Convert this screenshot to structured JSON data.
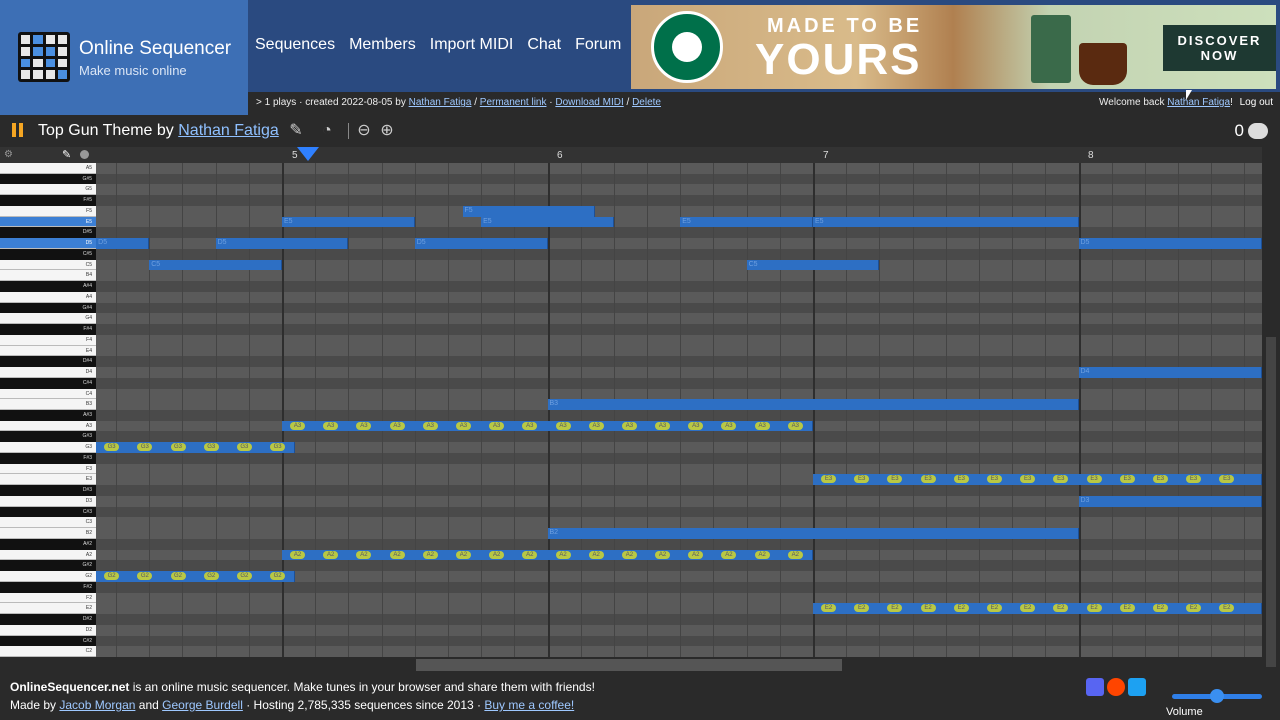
{
  "brand": {
    "title": "Online Sequencer",
    "subtitle": "Make music online"
  },
  "nav": {
    "items": [
      "Sequences",
      "Members",
      "Import MIDI",
      "Chat",
      "Forum"
    ]
  },
  "ad": {
    "line1": "MADE TO BE",
    "line2": "YOURS",
    "cta1": "DISCOVER",
    "cta2": "NOW",
    "colors": {
      "brand_green": "#00704a",
      "cta_bg": "#1e3932"
    }
  },
  "info": {
    "plays": "1 plays · created 2022-08-05 by",
    "author": "Nathan Fatiga",
    "permanent_link": "Permanent link",
    "download_midi": "Download MIDI",
    "delete": "Delete",
    "sep": "/",
    "welcome": "Welcome back",
    "welcome_user": "Nathan Fatiga",
    "logout": "Log out"
  },
  "toolbar": {
    "title_prefix": "Top Gun Theme by",
    "title_author": "Nathan Fatiga",
    "comment_count": "0",
    "icons": [
      "pause-icon",
      "edit-icon",
      "speed-icon",
      "zoom-out-icon",
      "zoom-in-icon",
      "comment-icon"
    ]
  },
  "timeline": {
    "bars": [
      "5",
      "6",
      "7",
      "8"
    ]
  },
  "keys": [
    "A5",
    "G#5",
    "G5",
    "F#5",
    "F5",
    "E5",
    "D#5",
    "D5",
    "C#5",
    "C5",
    "B4",
    "A#4",
    "A4",
    "G#4",
    "G4",
    "F#4",
    "F4",
    "E4",
    "D#4",
    "D4",
    "C#4",
    "C4",
    "B3",
    "A#3",
    "A3",
    "G#3",
    "G3",
    "F#3",
    "F3",
    "E3",
    "D#3",
    "D3",
    "C#3",
    "C3",
    "B2",
    "A#2",
    "A2",
    "G#2",
    "G2",
    "F#2",
    "F2",
    "E2",
    "D#2",
    "D2",
    "C#2",
    "C2"
  ],
  "notes": [
    {
      "key": "F5",
      "start": 0.68,
      "len": 0.5,
      "label": "F5"
    },
    {
      "key": "E5",
      "start": 0.0,
      "len": 0.5,
      "label": "E5"
    },
    {
      "key": "E5",
      "start": 0.75,
      "len": 0.5,
      "label": "E5"
    },
    {
      "key": "E5",
      "start": 1.5,
      "len": 0.5,
      "label": "E5"
    },
    {
      "key": "E5",
      "start": 2.0,
      "len": 1.0,
      "label": "E5"
    },
    {
      "key": "D5",
      "start": -0.7,
      "len": 0.2,
      "label": "D5"
    },
    {
      "key": "D5",
      "start": -0.25,
      "len": 0.5,
      "label": "D5"
    },
    {
      "key": "D5",
      "start": 0.5,
      "len": 0.5,
      "label": "D5"
    },
    {
      "key": "D5",
      "start": 3.0,
      "len": 0.7,
      "label": "D5"
    },
    {
      "key": "C5",
      "start": -0.5,
      "len": 0.5,
      "label": "C5"
    },
    {
      "key": "C5",
      "start": 1.75,
      "len": 0.5,
      "label": "C5"
    },
    {
      "key": "D4",
      "start": 3.0,
      "len": 0.7,
      "label": "D4"
    },
    {
      "key": "B3",
      "start": 1.0,
      "len": 2.0,
      "label": "B3"
    },
    {
      "key": "D3",
      "start": 3.0,
      "len": 0.7,
      "label": "D3"
    },
    {
      "key": "B2",
      "start": 1.0,
      "len": 2.0,
      "label": "B2"
    }
  ],
  "pills": [
    {
      "key": "G3",
      "start": -0.7,
      "count": 6,
      "label": "G3"
    },
    {
      "key": "A3",
      "start": 0.0,
      "count": 16,
      "label": "A3"
    },
    {
      "key": "E3",
      "start": 2.0,
      "count": 14,
      "label": "E3"
    },
    {
      "key": "G2",
      "start": -0.7,
      "count": 6,
      "label": "G2"
    },
    {
      "key": "A2",
      "start": 0.0,
      "count": 16,
      "label": "A2"
    },
    {
      "key": "E2",
      "start": 2.0,
      "count": 14,
      "label": "E2"
    }
  ],
  "footer": {
    "site": "OnlineSequencer.net",
    "desc": " is an online music sequencer. Make tunes in your browser and share them with friends!",
    "made_by": "Made by",
    "dev1": "Jacob Morgan",
    "and": "and",
    "dev2": "George Burdell",
    "hosting": "· Hosting 2,785,335 sequences since 2013 ·",
    "coffee": "Buy me a coffee!",
    "volume_label": "Volume",
    "volume_level": 0.45
  }
}
